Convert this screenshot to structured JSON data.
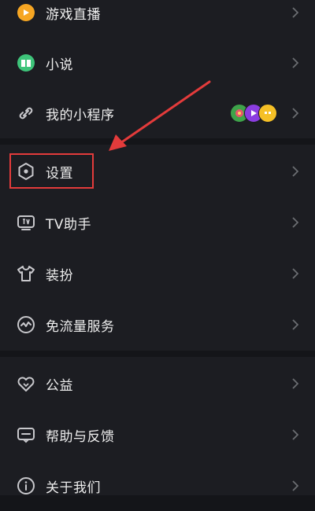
{
  "menu": {
    "items": [
      {
        "key": "live",
        "label": "游戏直播",
        "icon": "game-live-icon"
      },
      {
        "key": "novel",
        "label": "小说",
        "icon": "book-icon"
      },
      {
        "key": "mini_programs",
        "label": "我的小程序",
        "icon": "link-icon"
      },
      {
        "key": "settings",
        "label": "设置",
        "icon": "hexagon-settings-icon"
      },
      {
        "key": "tv",
        "label": "TV助手",
        "icon": "tv-icon"
      },
      {
        "key": "dress_up",
        "label": "装扮",
        "icon": "tshirt-icon"
      },
      {
        "key": "free_data",
        "label": "免流量服务",
        "icon": "wave-icon"
      },
      {
        "key": "charity",
        "label": "公益",
        "icon": "heart-icon"
      },
      {
        "key": "help",
        "label": "帮助与反馈",
        "icon": "chat-icon"
      },
      {
        "key": "about",
        "label": "关于我们",
        "icon": "info-icon"
      }
    ]
  },
  "mini_program_badges": [
    "flower-badge",
    "play-badge",
    "face-badge"
  ],
  "colors": {
    "background": "#141519",
    "section": "#1c1d22",
    "highlight": "#e33b3b",
    "text": "#eeeeee",
    "icon": "#c8c8cc",
    "chevron": "#6b6d72",
    "live_icon": "#f6a623",
    "novel_icon": "#3ec47a"
  }
}
